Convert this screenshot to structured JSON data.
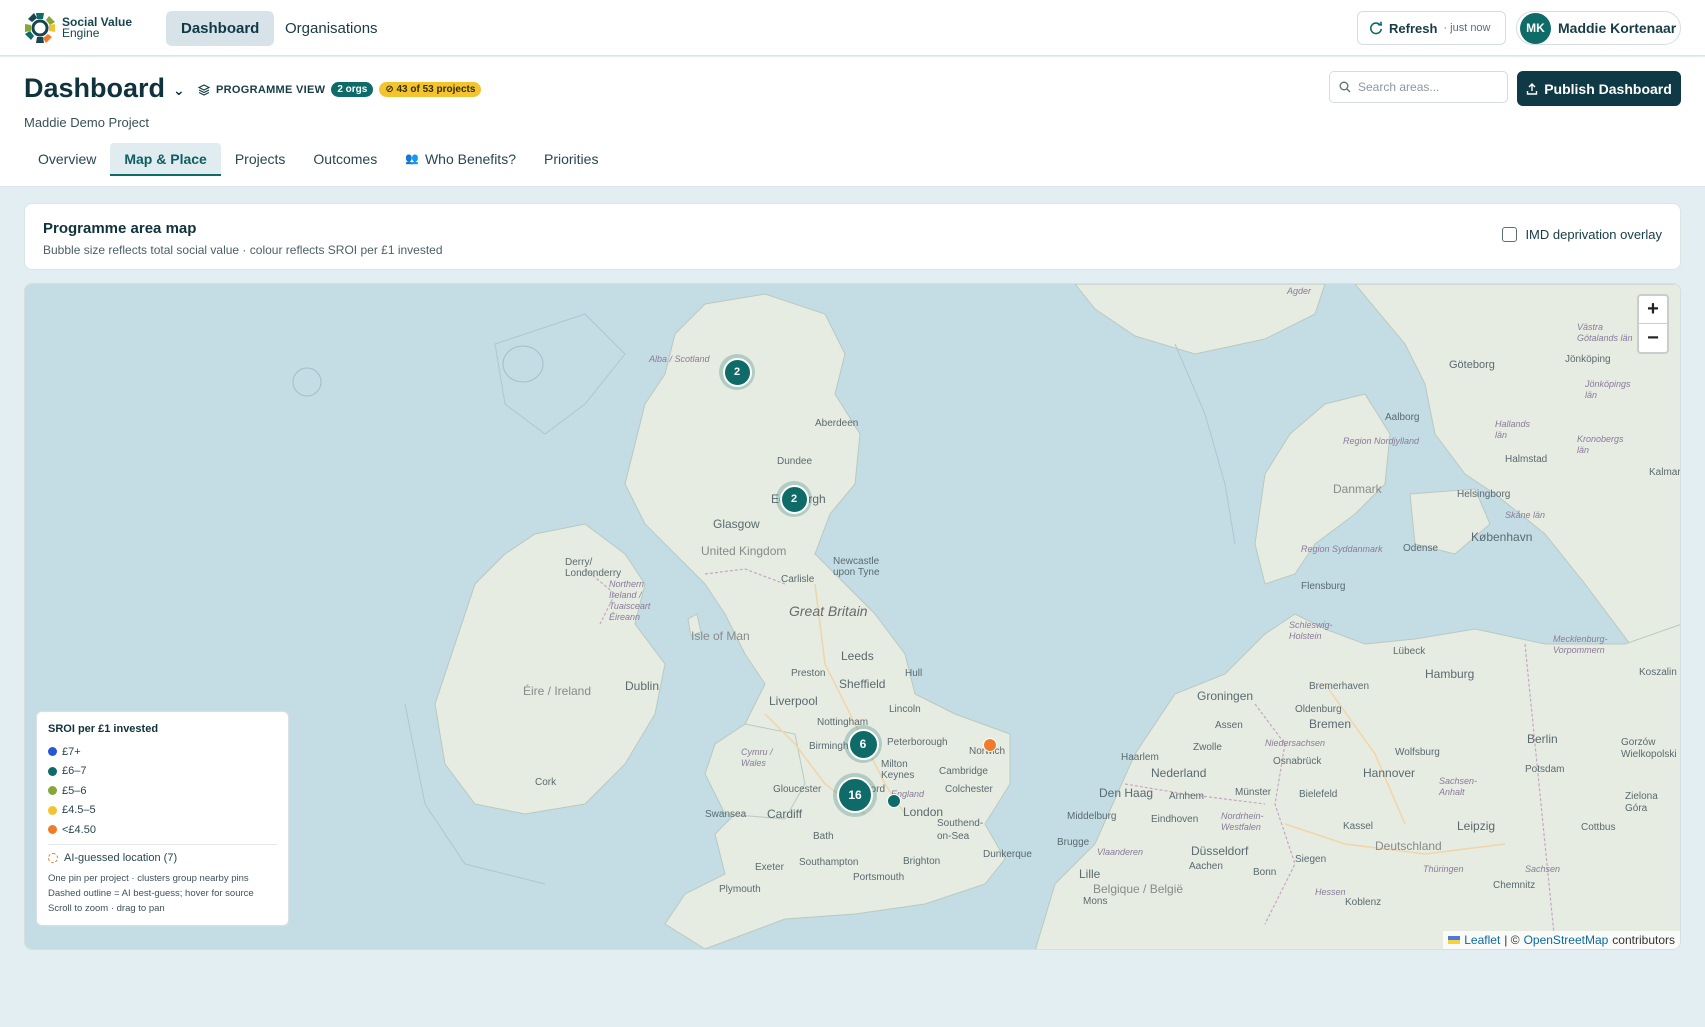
{
  "app": {
    "logo_line1": "Social Value",
    "logo_line2": "Engine",
    "nav": [
      "Dashboard",
      "Organisations"
    ],
    "refresh_label": "Refresh",
    "refresh_ago": "· just now",
    "user_initials": "MK",
    "user_name": "Maddie Kortenaar"
  },
  "header": {
    "title": "Dashboard",
    "programme_view": "PROGRAMME VIEW",
    "orgs_badge": "2 orgs",
    "projects_badge": "43 of 53 projects",
    "subtitle": "Maddie Demo Project",
    "search_placeholder": "Search areas...",
    "publish_label": "Publish Dashboard",
    "tabs": [
      "Overview",
      "Map & Place",
      "Projects",
      "Outcomes",
      "Who Benefits?",
      "Priorities"
    ],
    "active_tab": "Map & Place"
  },
  "map_card": {
    "title": "Programme area map",
    "subtitle": "Bubble size reflects total social value · colour reflects SROI per £1 invested",
    "overlay_label": "IMD deprivation overlay",
    "overlay_checked": false
  },
  "map": {
    "place_labels": [
      "Alba / Scotland",
      "Aberdeen",
      "Dundee",
      "Edinburgh",
      "Glasgow",
      "United Kingdom",
      "Carlisle",
      "Newcastle upon Tyne",
      "Great Britain",
      "Derry/ Londonderry",
      "Northern Ireland / Tuaisceart Éireann",
      "Isle of Man",
      "Éire / Ireland",
      "Dublin",
      "Leeds",
      "Preston",
      "Sheffield",
      "Hull",
      "Liverpool",
      "Nottingham",
      "Lincoln",
      "Birmingham",
      "Peterborough",
      "Norwich",
      "Cymru / Wales",
      "Milton Keynes",
      "Cambridge",
      "England",
      "Gloucester",
      "Oxford",
      "Colchester",
      "Cork",
      "Swansea",
      "Cardiff",
      "London",
      "Southend-on-Sea",
      "Bath",
      "Southampton",
      "Portsmouth",
      "Brighton",
      "Exeter",
      "Plymouth",
      "Dunkerque",
      "Agder",
      "Aberdeen",
      "Aalborg",
      "Region Nordjylland",
      "Danmark",
      "Göteborg",
      "Jönköping",
      "Hallands län",
      "Halmstad",
      "Kronobergs län",
      "Helsingborg",
      "København",
      "Skåne län",
      "Region Syddanmark",
      "Odense",
      "Flensburg",
      "Schleswig-Holstein",
      "Mecklenburg-Vorpommern",
      "Lübeck",
      "Hamburg",
      "Groningen",
      "Oldenburg",
      "Bremerhaven",
      "Bremen",
      "Assen",
      "Zwolle",
      "Haarlem",
      "Nederland",
      "Niedersachsen",
      "Osnabrück",
      "Wolfsburg",
      "Hannover",
      "Berlin",
      "Potsdam",
      "Den Haag",
      "Arnhem",
      "Münster",
      "Bielefeld",
      "Sachsen-Anhalt",
      "Middelburg",
      "Eindhoven",
      "Nordrhein-Westfalen",
      "Kassel",
      "Leipzig",
      "Brugge",
      "Vlaanderen",
      "Düsseldorf",
      "Aachen",
      "Siegen",
      "Deutschland",
      "Lille",
      "Belgique / België",
      "Bonn",
      "Mons",
      "Hessen",
      "Koblenz",
      "Thüringen",
      "Chemnitz",
      "Sachsen",
      "Cottbus",
      "Zielona Góra",
      "Gorzów Wielkopolski",
      "Koszalin",
      "Kalmar",
      "Västra Götalands län",
      "Jönköpings län"
    ],
    "clusters": [
      {
        "label": "2",
        "size": "small"
      },
      {
        "label": "2",
        "size": "small"
      },
      {
        "label": "6",
        "size": "medium"
      },
      {
        "label": "16",
        "size": "large"
      }
    ],
    "pins": [
      {
        "place": "Norwich",
        "color": "#f07c2b"
      },
      {
        "place": "Oxford",
        "color": "#0e6b68"
      }
    ],
    "zoom_in": "+",
    "zoom_out": "−",
    "attribution_leaflet": "Leaflet",
    "attribution_sep": "| ©",
    "attribution_osm": "OpenStreetMap",
    "attribution_tail": "contributors"
  },
  "legend": {
    "title": "SROI per £1 invested",
    "items": [
      {
        "label": "£7+",
        "color": "#2a55d6"
      },
      {
        "label": "£6–7",
        "color": "#0e6b68"
      },
      {
        "label": "£5–6",
        "color": "#86a83a"
      },
      {
        "label": "£4.5–5",
        "color": "#f2c530"
      },
      {
        "label": "<£4.50",
        "color": "#f07c2b"
      }
    ],
    "ai_label": "AI-guessed location (7)",
    "notes": [
      "One pin per project · clusters group nearby pins",
      "Dashed outline = AI best-guess; hover for source",
      "Scroll to zoom · drag to pan"
    ]
  }
}
